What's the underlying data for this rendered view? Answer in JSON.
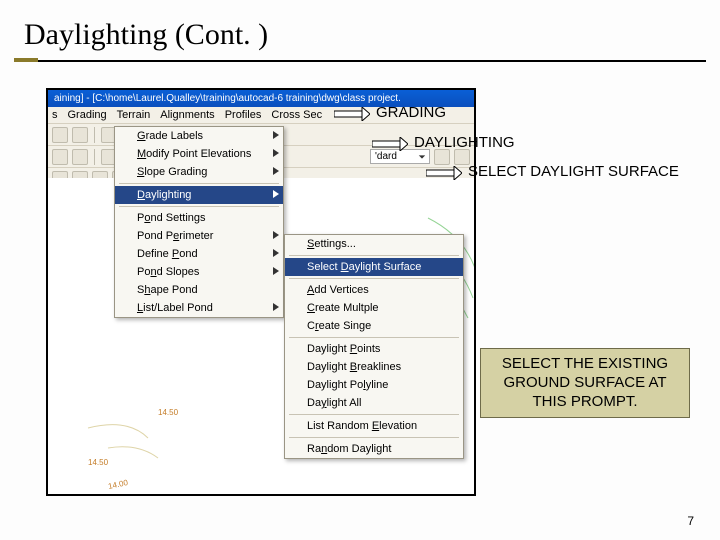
{
  "slide": {
    "title": "Daylighting (Cont. )",
    "page_number": "7"
  },
  "app": {
    "titlebar_text": "aining] - [C:\\home\\Laurel.Qualley\\training\\autocad-6 training\\dwg\\class project.",
    "menubar": [
      "s",
      "Grading",
      "Terrain",
      "Alignments",
      "Profiles",
      "Cross Sec"
    ],
    "layer_dropdown": "'dard"
  },
  "grading_menu": {
    "items": [
      {
        "label_pre": "",
        "mnemonic": "G",
        "label_post": "rade Labels"
      },
      {
        "label_pre": "",
        "mnemonic": "M",
        "label_post": "odify Point Elevations"
      },
      {
        "label_pre": "",
        "mnemonic": "S",
        "label_post": "lope Grading"
      },
      {
        "label_pre": "",
        "mnemonic": "D",
        "label_post": "aylighting"
      },
      {
        "label_pre": "P",
        "mnemonic": "o",
        "label_post": "nd Settings"
      },
      {
        "label_pre": "Pond P",
        "mnemonic": "e",
        "label_post": "rimeter"
      },
      {
        "label_pre": "Define ",
        "mnemonic": "P",
        "label_post": "ond"
      },
      {
        "label_pre": "Po",
        "mnemonic": "n",
        "label_post": "d Slopes"
      },
      {
        "label_pre": "S",
        "mnemonic": "h",
        "label_post": "ape Pond"
      },
      {
        "label_pre": "",
        "mnemonic": "L",
        "label_post": "ist/Label Pond"
      }
    ]
  },
  "daylight_submenu": {
    "items": [
      {
        "label_pre": "",
        "mnemonic": "S",
        "label_post": "ettings..."
      },
      {
        "label_pre": "Select ",
        "mnemonic": "D",
        "label_post": "aylight Surface"
      },
      {
        "label_pre": "",
        "mnemonic": "A",
        "label_post": "dd Vertices"
      },
      {
        "label_pre": "",
        "mnemonic": "C",
        "label_post": "reate Multple"
      },
      {
        "label_pre": "C",
        "mnemonic": "r",
        "label_post": "eate Singe"
      },
      {
        "label_pre": "Daylight ",
        "mnemonic": "P",
        "label_post": "oints"
      },
      {
        "label_pre": "Daylight ",
        "mnemonic": "B",
        "label_post": "reaklines"
      },
      {
        "label_pre": "Daylight Po",
        "mnemonic": "l",
        "label_post": "yline"
      },
      {
        "label_pre": "Da",
        "mnemonic": "y",
        "label_post": "light All"
      },
      {
        "label_pre": "List Random ",
        "mnemonic": "E",
        "label_post": "levation"
      },
      {
        "label_pre": "Ra",
        "mnemonic": "n",
        "label_post": "dom Daylight"
      }
    ]
  },
  "callouts": {
    "grading": "GRADING",
    "daylighting": "DAYLIGHTING",
    "select_surface": "SELECT DAYLIGHT SURFACE",
    "instruction": "SELECT THE EXISTING GROUND SURFACE AT THIS PROMPT."
  },
  "contours": {
    "label1": "14.50",
    "label2": "14.50",
    "label3": "14.00"
  }
}
